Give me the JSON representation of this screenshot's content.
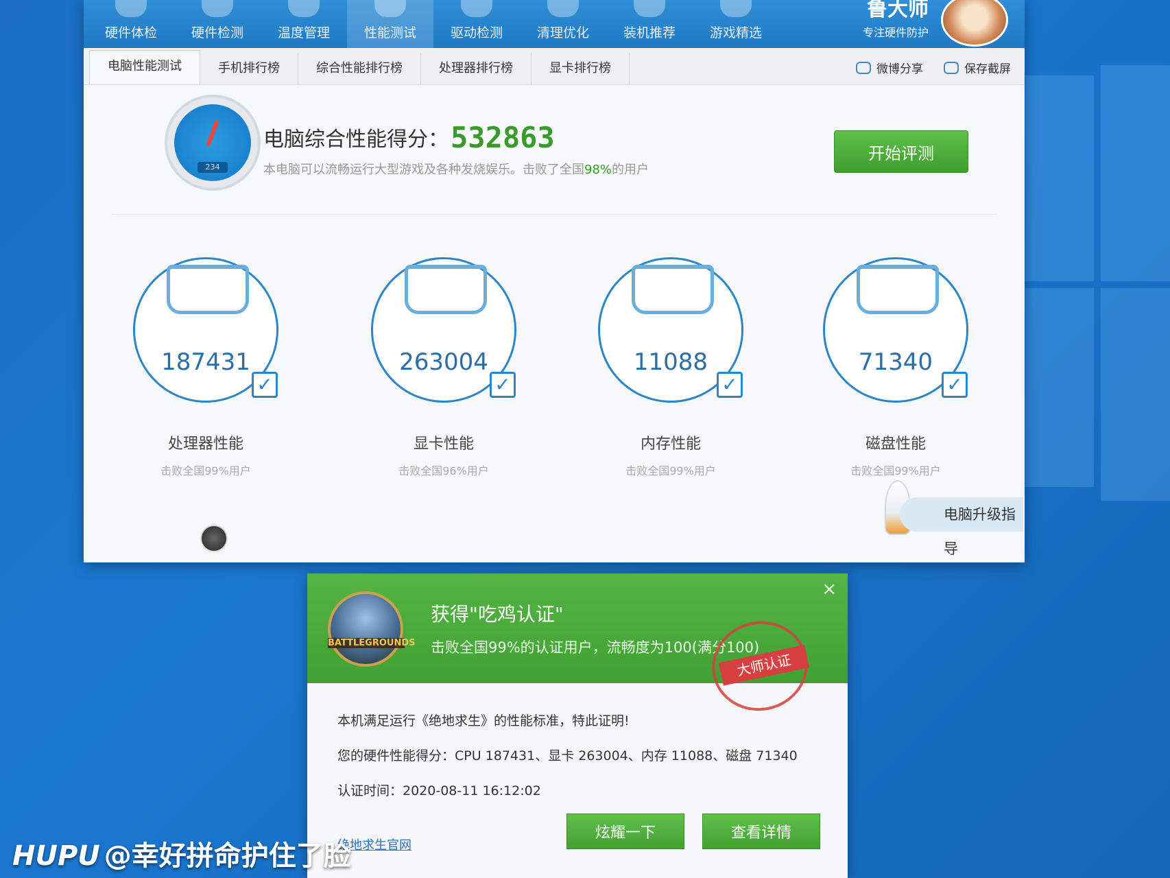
{
  "app": {
    "nav": [
      {
        "label": "硬件体检"
      },
      {
        "label": "硬件检测"
      },
      {
        "label": "温度管理"
      },
      {
        "label": "性能测试"
      },
      {
        "label": "驱动检测"
      },
      {
        "label": "清理优化"
      },
      {
        "label": "装机推荐"
      },
      {
        "label": "游戏精选"
      }
    ],
    "brand_name": "鲁大师",
    "brand_slogan": "专注硬件防护",
    "subtabs": [
      "电脑性能测试",
      "手机排行榜",
      "综合性能排行榜",
      "处理器排行榜",
      "显卡排行榜"
    ],
    "share": "微博分享",
    "screenshot": "保存截屏"
  },
  "score": {
    "gauge_number": "234",
    "title": "电脑综合性能得分：",
    "value": "532863",
    "desc_prefix": "本电脑可以流畅运行大型游戏及各种发烧娱乐。击败了全国",
    "desc_percent": "98%",
    "desc_suffix": "的用户",
    "start_button": "开始评测"
  },
  "cards": [
    {
      "value": "187431",
      "label": "处理器性能",
      "sub": "击败全国99%用户",
      "icon": "cpu-monitor-icon"
    },
    {
      "value": "263004",
      "label": "显卡性能",
      "sub": "击败全国96%用户",
      "icon": "gpu-cube-icon"
    },
    {
      "value": "11088",
      "label": "内存性能",
      "sub": "击败全国99%用户",
      "icon": "memory-chip-icon"
    },
    {
      "value": "71340",
      "label": "磁盘性能",
      "sub": "击败全国99%用户",
      "icon": "disk-drive-icon"
    }
  ],
  "upgrade": "电脑升级指导",
  "popup": {
    "title": "获得\"吃鸡认证\"",
    "subtitle": "击败全国99%的认证用户，流畅度为100(满分100)",
    "stamp": "大师认证",
    "badge_text": "BATTLEGROUNDS",
    "line1": "本机满足运行《绝地求生》的性能标准，特此证明!",
    "line2": "您的硬件性能得分：CPU 187431、显卡 263004、内存 11088、磁盘 71340",
    "line3": "认证时间：2020-08-11 16:12:02",
    "link": "绝地求生官网",
    "btn_show": "炫耀一下",
    "btn_detail": "查看详情",
    "close": "×"
  },
  "watermark": {
    "logo": "HUPU",
    "user": "@幸好拼命护住了脸"
  }
}
